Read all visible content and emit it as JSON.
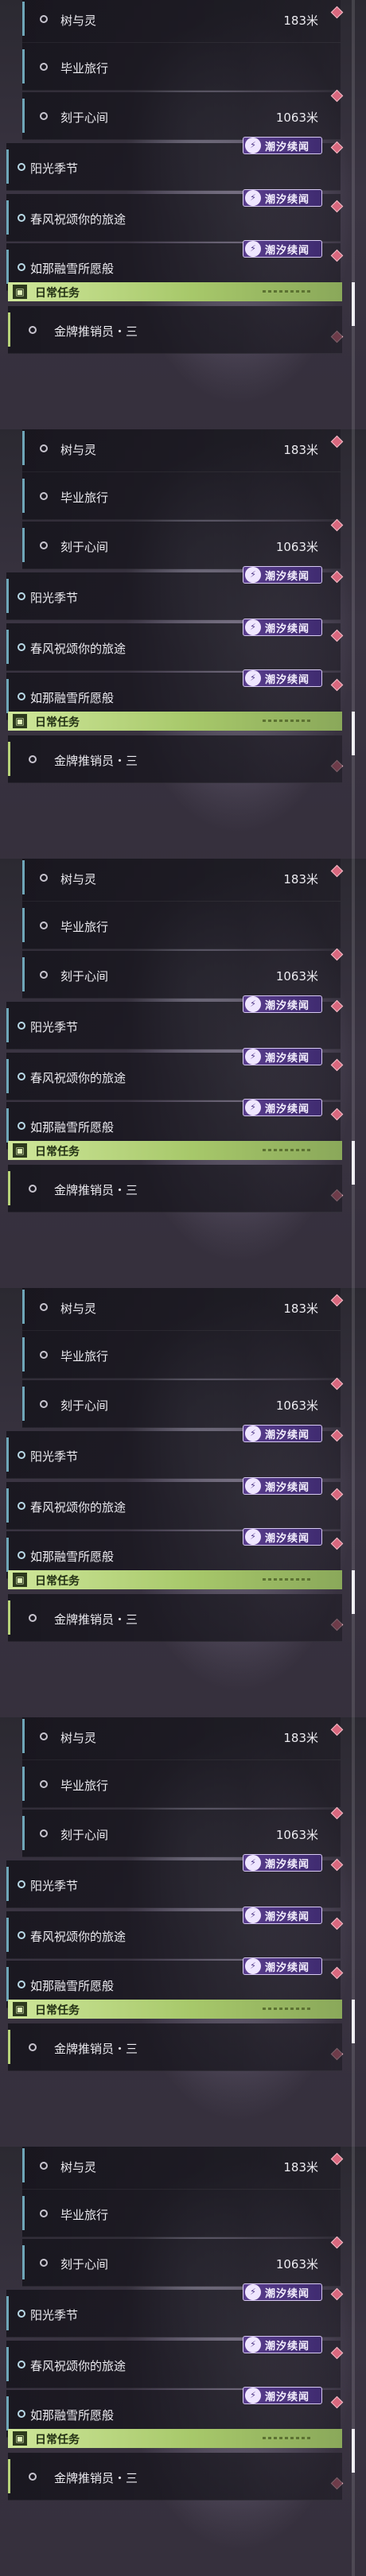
{
  "quests": [
    {
      "kind": "sub",
      "label": "树与灵",
      "distance": "183米"
    },
    {
      "kind": "sub",
      "label": "毕业旅行",
      "distance": ""
    },
    {
      "kind": "sub",
      "label": "刻于心间",
      "distance": "1063米"
    },
    {
      "kind": "main",
      "label": "阳光季节",
      "distance": ""
    },
    {
      "kind": "main",
      "label": "春风祝颂你的旅途",
      "distance": ""
    },
    {
      "kind": "main",
      "label": "如那融雪所愿般",
      "distance": ""
    }
  ],
  "event_badge": {
    "label": "潮汐续闻",
    "icon": "tide-event-icon",
    "color": "#5a3e8e"
  },
  "daily": {
    "title": "日常任务",
    "task": "金牌推销员・三",
    "color": "#cfe79a"
  },
  "accent": {
    "quest_bar": "#6fa6b8",
    "marker": "#d9687e"
  },
  "panel_count": 6
}
